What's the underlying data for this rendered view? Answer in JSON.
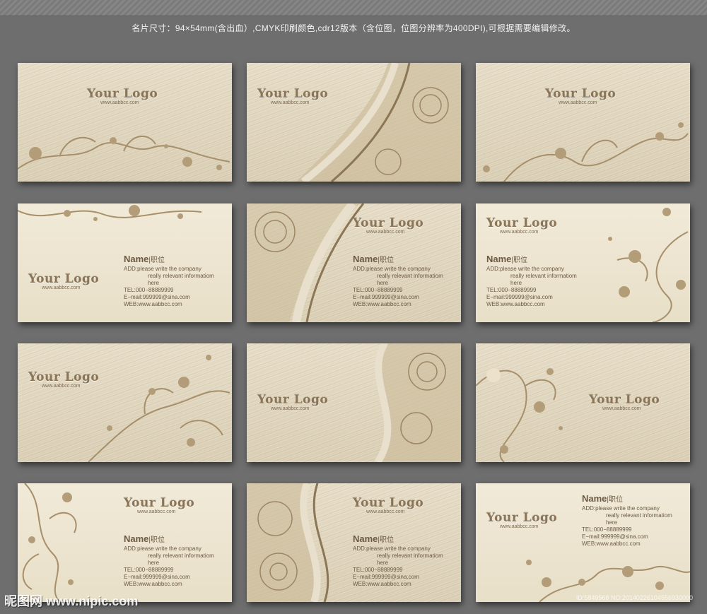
{
  "header": {
    "caption": "名片尺寸：94×54mm(含出血）,CMYK印刷颜色,cdr12版本（含位图，位图分辨率为400DPI),可根据需要编辑修改。"
  },
  "card": {
    "logo": "Your Logo",
    "url": "www.aabbcc.com",
    "name": "Name",
    "title": "|职位",
    "add1": "ADD:please write the company",
    "add2": "really relevant informatiom",
    "add3": "here",
    "tel": "TEL:000−88889999",
    "email": "E−mail:999999@sina.com",
    "web": "WEB:www.aabbcc.com"
  },
  "watermark": {
    "site": "昵图网 www.nipic.com",
    "id": "ID:5849568 NO:20140226104556930000"
  },
  "colors": {
    "ornament": "#b39d79",
    "ornament_dark": "#8b7656",
    "background": "#6e6e6e"
  }
}
